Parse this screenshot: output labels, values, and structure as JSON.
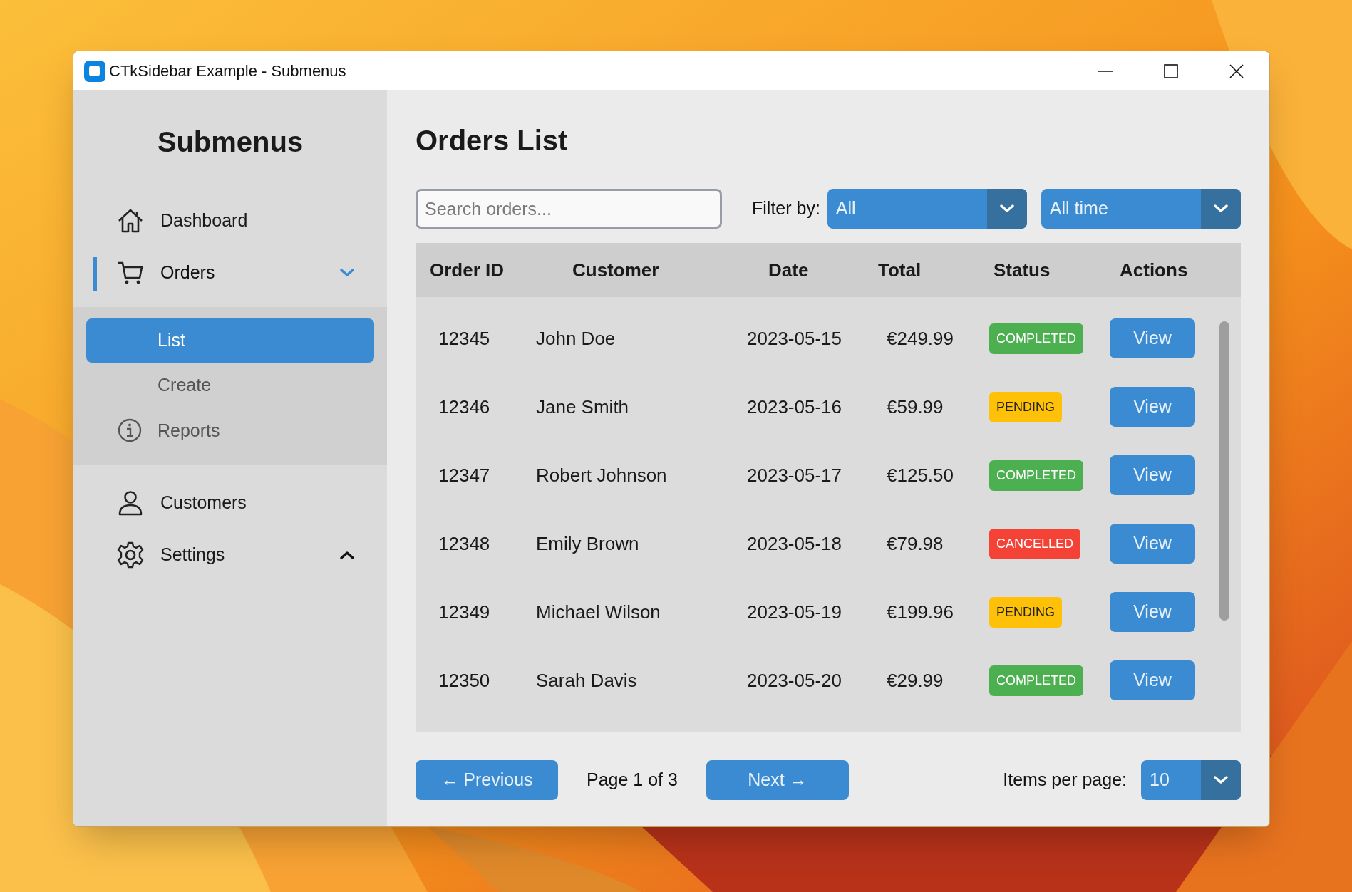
{
  "window": {
    "title": "CTkSidebar Example - Submenus"
  },
  "sidebar": {
    "title": "Submenus",
    "items": [
      {
        "label": "Dashboard",
        "active": false
      },
      {
        "label": "Orders",
        "active": true,
        "expanded": true,
        "children": [
          {
            "label": "List",
            "selected": true
          },
          {
            "label": "Create",
            "selected": false
          },
          {
            "label": "Reports",
            "selected": false
          }
        ]
      },
      {
        "label": "Customers",
        "active": false
      },
      {
        "label": "Settings",
        "active": false,
        "expanded": false
      }
    ]
  },
  "main": {
    "title": "Orders List",
    "search": {
      "placeholder": "Search orders..."
    },
    "filter_label": "Filter by:",
    "filters": [
      {
        "value": "All"
      },
      {
        "value": "All time"
      }
    ],
    "table": {
      "columns": [
        "Order ID",
        "Customer",
        "Date",
        "Total",
        "Status",
        "Actions"
      ],
      "rows": [
        {
          "id": "12345",
          "customer": "John Doe",
          "date": "2023-05-15",
          "total": "€249.99",
          "status": "COMPLETED",
          "color": "#4caf50",
          "action": "View"
        },
        {
          "id": "12346",
          "customer": "Jane Smith",
          "date": "2023-05-16",
          "total": "€59.99",
          "status": "PENDING",
          "color": "#ffc107",
          "action": "View"
        },
        {
          "id": "12347",
          "customer": "Robert Johnson",
          "date": "2023-05-17",
          "total": "€125.50",
          "status": "COMPLETED",
          "color": "#4caf50",
          "action": "View"
        },
        {
          "id": "12348",
          "customer": "Emily Brown",
          "date": "2023-05-18",
          "total": "€79.98",
          "status": "CANCELLED",
          "color": "#f44336",
          "action": "View"
        },
        {
          "id": "12349",
          "customer": "Michael Wilson",
          "date": "2023-05-19",
          "total": "€199.96",
          "status": "PENDING",
          "color": "#ffc107",
          "action": "View"
        },
        {
          "id": "12350",
          "customer": "Sarah Davis",
          "date": "2023-05-20",
          "total": "€29.99",
          "status": "COMPLETED",
          "color": "#4caf50",
          "action": "View"
        }
      ]
    },
    "pagination": {
      "previous": "← Previous",
      "page": "Page 1 of 3",
      "next": "Next →",
      "items_label": "Items per page:",
      "items_value": "10"
    }
  }
}
